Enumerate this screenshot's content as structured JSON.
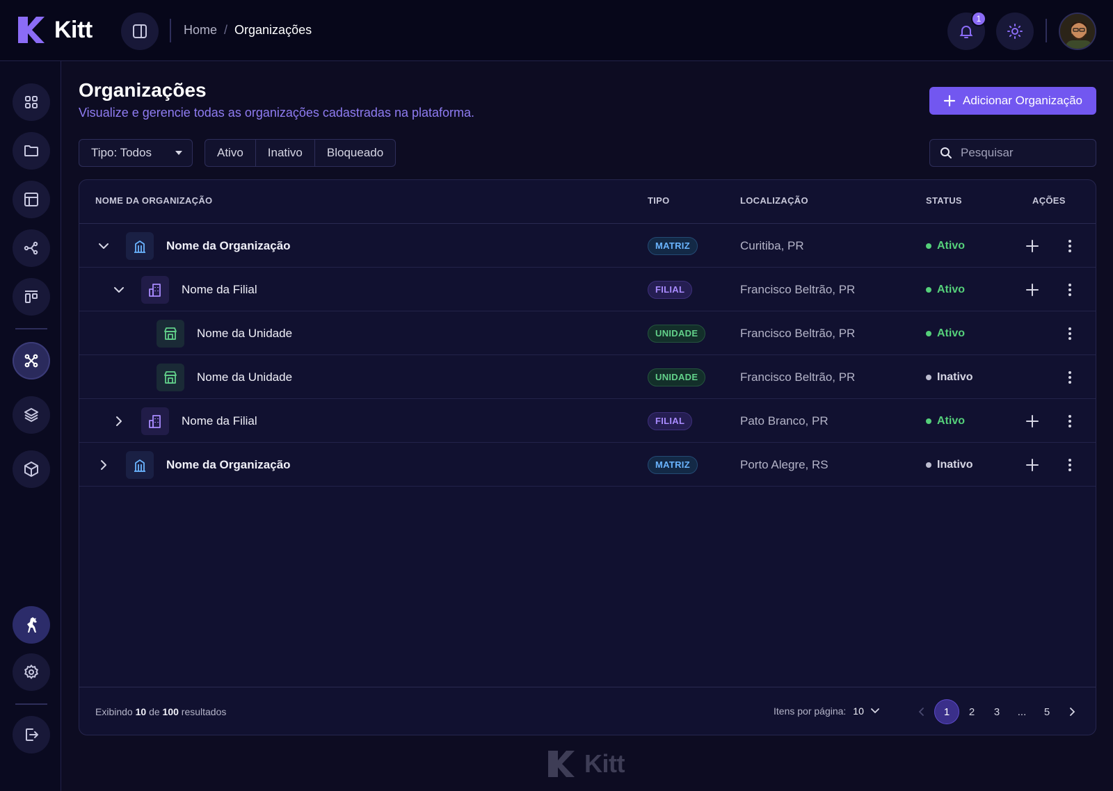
{
  "app": {
    "name": "Kitt"
  },
  "breadcrumb": {
    "home": "Home",
    "separator": "/",
    "current": "Organizações"
  },
  "notifications": {
    "count": "1"
  },
  "page": {
    "title": "Organizações",
    "subtitle": "Visualize e gerencie todas as organizações cadastradas na plataforma.",
    "add_button": "Adicionar Organização"
  },
  "filters": {
    "type_select": "Tipo: Todos",
    "status_segments": [
      "Ativo",
      "Inativo",
      "Bloqueado"
    ],
    "search_placeholder": "Pesquisar"
  },
  "table": {
    "headers": {
      "name": "NOME DA ORGANIZAÇÃO",
      "type": "TIPO",
      "location": "LOCALIZAÇÃO",
      "status": "STATUS",
      "actions": "AÇÕES"
    },
    "rows": [
      {
        "name": "Nome da Organização",
        "type": "MATRIZ",
        "location": "Curitiba, PR",
        "status": "Ativo"
      },
      {
        "name": "Nome da Filial",
        "type": "FILIAL",
        "location": "Francisco Beltrão, PR",
        "status": "Ativo"
      },
      {
        "name": "Nome da Unidade",
        "type": "UNIDADE",
        "location": "Francisco Beltrão, PR",
        "status": "Ativo"
      },
      {
        "name": "Nome da Unidade",
        "type": "UNIDADE",
        "location": "Francisco Beltrão, PR",
        "status": "Inativo"
      },
      {
        "name": "Nome da Filial",
        "type": "FILIAL",
        "location": "Pato Branco, PR",
        "status": "Ativo"
      },
      {
        "name": "Nome da Organização",
        "type": "MATRIZ",
        "location": "Porto Alegre, RS",
        "status": "Inativo"
      }
    ]
  },
  "footer": {
    "summary_prefix": "Exibindo",
    "shown": "10",
    "summary_mid": "de",
    "total": "100",
    "summary_suffix": "resultados",
    "per_page_label": "Itens por página:",
    "per_page_value": "10",
    "pages": [
      "1",
      "2",
      "3",
      "...",
      "5"
    ]
  },
  "colors": {
    "accent": "#7257f0",
    "active_status": "#55d07a",
    "matriz": "#6ab4ff",
    "filial": "#a98bff",
    "unidade": "#62d18a"
  },
  "icons": {
    "sidebar": [
      "grid-icon",
      "folder-icon",
      "table-icon",
      "share-icon",
      "kanban-icon",
      "network-icon",
      "layers-icon",
      "cube-icon",
      "horse-icon",
      "gear-icon",
      "logout-icon"
    ]
  }
}
